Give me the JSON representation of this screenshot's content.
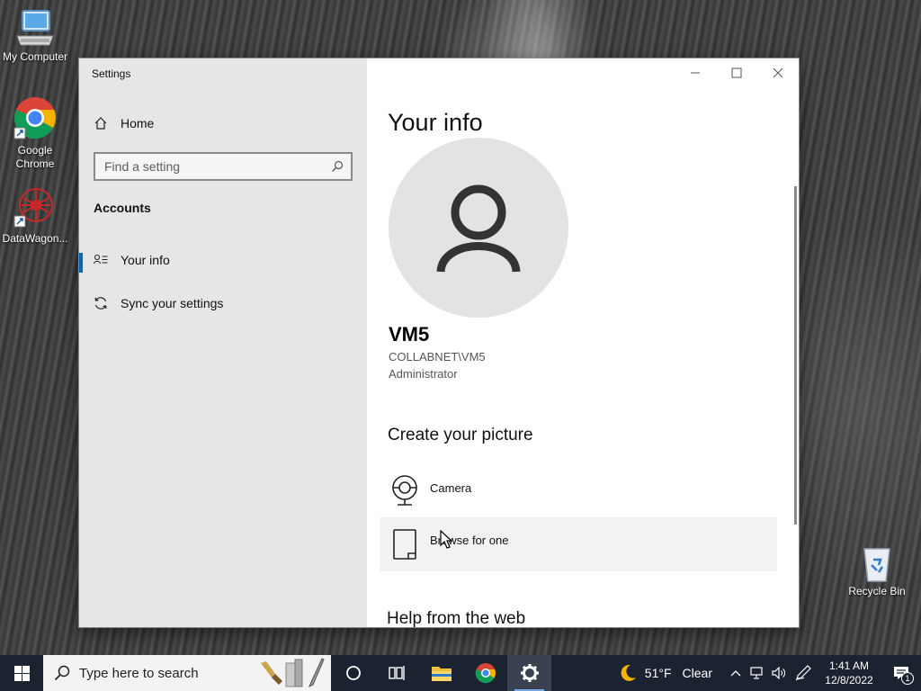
{
  "desktop": {
    "icons": [
      {
        "label": "My Computer"
      },
      {
        "label": "Google Chrome"
      },
      {
        "label": "DataWagon..."
      },
      {
        "label": "Recycle Bin"
      }
    ]
  },
  "window": {
    "title": "Settings",
    "controls": {
      "minimize": "minimize",
      "maximize": "maximize",
      "close": "close"
    }
  },
  "nav": {
    "home_label": "Home",
    "search_placeholder": "Find a setting",
    "section_label": "Accounts",
    "items": [
      {
        "label": "Your info",
        "icon": "person-list-icon",
        "active": true
      },
      {
        "label": "Sync your settings",
        "icon": "sync-icon",
        "active": false
      }
    ]
  },
  "main": {
    "title": "Your info",
    "user": {
      "name": "VM5",
      "account": "COLLABNET\\VM5",
      "role": "Administrator"
    },
    "picture_section_title": "Create your picture",
    "picture_options": [
      {
        "label": "Camera",
        "icon": "camera-icon"
      },
      {
        "label": "Browse for one",
        "icon": "browse-icon"
      }
    ],
    "help_title": "Help from the web"
  },
  "taskbar": {
    "search_placeholder": "Type here to search",
    "weather": {
      "temp": "51°F",
      "condition": "Clear"
    },
    "clock": {
      "time": "1:41 AM",
      "date": "12/8/2022"
    },
    "notification_count": "1"
  },
  "colors": {
    "accent": "#0067c0",
    "nav_bg": "#e6e6e6",
    "taskbar_bg": "#1c2330"
  }
}
